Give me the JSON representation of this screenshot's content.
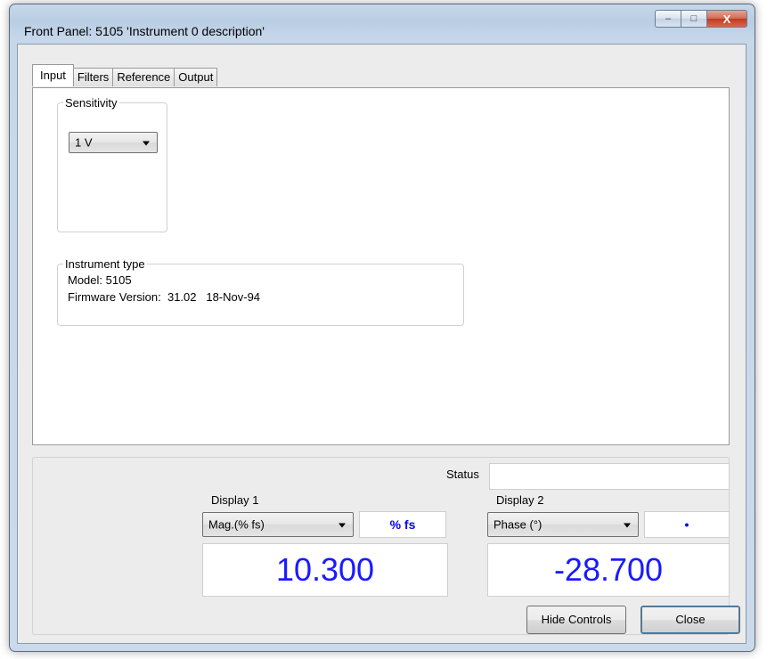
{
  "window": {
    "title": "Front Panel: 5105 'Instrument 0 description'"
  },
  "titlebar_buttons": {
    "minimize_icon": "–",
    "maximize_icon": "□",
    "close_icon": "X"
  },
  "tabs": [
    {
      "label": "Input",
      "active": true
    },
    {
      "label": "Filters",
      "active": false
    },
    {
      "label": "Reference",
      "active": false
    },
    {
      "label": "Output",
      "active": false
    }
  ],
  "input_tab": {
    "sensitivity": {
      "legend": "Sensitivity",
      "selected": "1 V"
    },
    "instrument_type": {
      "legend": "Instrument type",
      "model_line": "Model: 5105",
      "firmware_line": "Firmware Version:  31.02   18-Nov-94"
    }
  },
  "status": {
    "label": "Status",
    "value": ""
  },
  "display1": {
    "label": "Display 1",
    "selected": "Mag.(% fs)",
    "unit": "% fs",
    "value": "10.300"
  },
  "display2": {
    "label": "Display 2",
    "selected": "Phase (°)",
    "unit": "•",
    "value": "-28.700"
  },
  "buttons": {
    "hide_controls": "Hide Controls",
    "close": "Close"
  },
  "colors": {
    "value_blue": "#1a1aff",
    "unit_blue": "#0000ee"
  }
}
